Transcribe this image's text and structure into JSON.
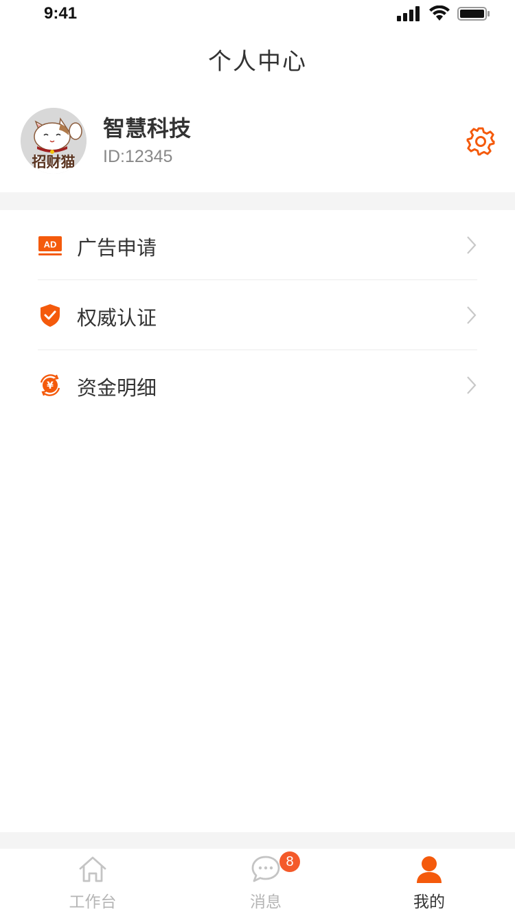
{
  "status_bar": {
    "time": "9:41"
  },
  "header": {
    "title": "个人中心"
  },
  "profile": {
    "name": "智慧科技",
    "id_text": "ID:12345",
    "avatar_text": "招财猫"
  },
  "menu": {
    "items": [
      {
        "label": "广告申请",
        "icon": "ad-icon",
        "icon_text": "AD"
      },
      {
        "label": "权威认证",
        "icon": "shield-check-icon"
      },
      {
        "label": "资金明细",
        "icon": "yuan-cycle-icon",
        "icon_text": "¥"
      }
    ]
  },
  "tabbar": {
    "items": [
      {
        "label": "工作台",
        "icon": "home-icon",
        "active": false
      },
      {
        "label": "消息",
        "icon": "chat-icon",
        "badge": "8",
        "active": false
      },
      {
        "label": "我的",
        "icon": "user-icon",
        "active": true
      }
    ]
  },
  "colors": {
    "accent": "#f45a0c",
    "badge": "#f45a2a",
    "inactive": "#b5b5b5",
    "band": "#f4f4f4"
  }
}
